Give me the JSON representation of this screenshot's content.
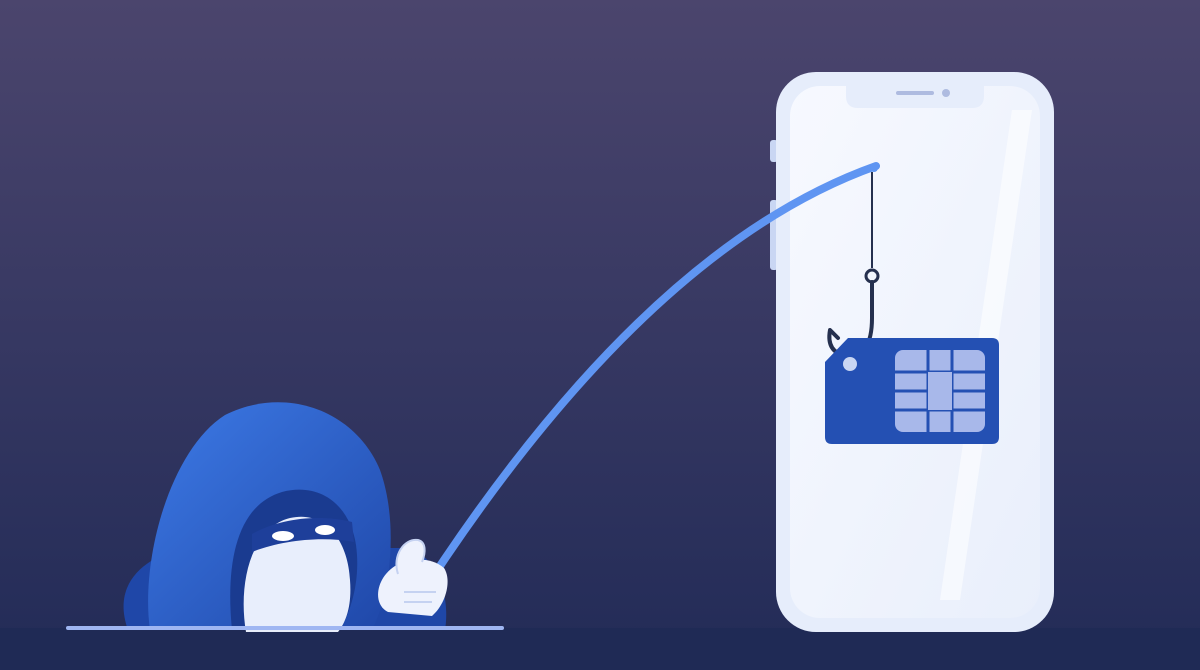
{
  "scene": {
    "subject": "sim-swap-phishing-illustration",
    "colors": {
      "background_top": "#4b456d",
      "background_bottom": "#222b57",
      "floor": "#1f2a55",
      "floor_line": "#9fb6f2",
      "phone_frame": "#e6edfb",
      "phone_screen": "#f4f7fe",
      "hood_dark": "#1f47a8",
      "hood_light": "#3d7ae6",
      "face": "#e8eefc",
      "mask": "#1e3f9a",
      "fishing_rod": "#5f95f2",
      "fishing_line": "#25304f",
      "sim_card": "#2450b3",
      "sim_chip": "#a8b8ea"
    },
    "icons": [
      "hacker-figure-icon",
      "fishing-rod-icon",
      "fish-hook-icon",
      "sim-card-icon",
      "sim-chip-icon",
      "smartphone-icon"
    ]
  }
}
